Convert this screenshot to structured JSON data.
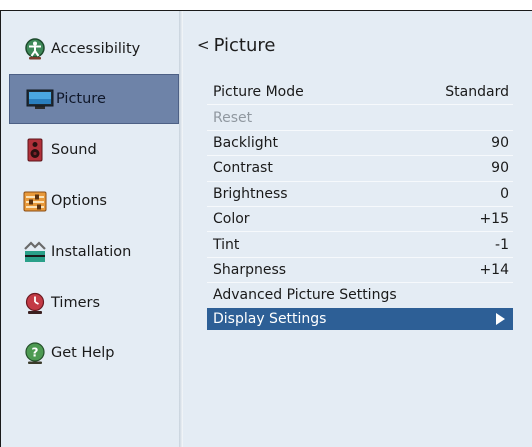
{
  "sidebar": {
    "items": [
      {
        "label": "Accessibility",
        "icon": "accessibility-icon"
      },
      {
        "label": "Picture",
        "icon": "picture-icon"
      },
      {
        "label": "Sound",
        "icon": "speaker-icon"
      },
      {
        "label": "Options",
        "icon": "options-icon"
      },
      {
        "label": "Installation",
        "icon": "installation-icon"
      },
      {
        "label": "Timers",
        "icon": "timer-icon"
      },
      {
        "label": "Get Help",
        "icon": "help-icon"
      }
    ],
    "active_index": 1
  },
  "main": {
    "back_chevron": "<",
    "title": "Picture",
    "rows": [
      {
        "label": "Picture Mode",
        "value": "Standard"
      },
      {
        "label": "Reset",
        "value": ""
      },
      {
        "label": "Backlight",
        "value": "90"
      },
      {
        "label": "Contrast",
        "value": "90"
      },
      {
        "label": "Brightness",
        "value": "0"
      },
      {
        "label": "Color",
        "value": "+15"
      },
      {
        "label": "Tint",
        "value": "-1"
      },
      {
        "label": "Sharpness",
        "value": "+14"
      },
      {
        "label": "Advanced Picture Settings",
        "value": ""
      },
      {
        "label": "Display Settings",
        "value": ""
      }
    ],
    "selected_index": 9,
    "disabled_index": 1
  },
  "colors": {
    "background": "#e4ecf4",
    "active_sidebar": "#6e83a8",
    "selected_row": "#2d5f96"
  }
}
